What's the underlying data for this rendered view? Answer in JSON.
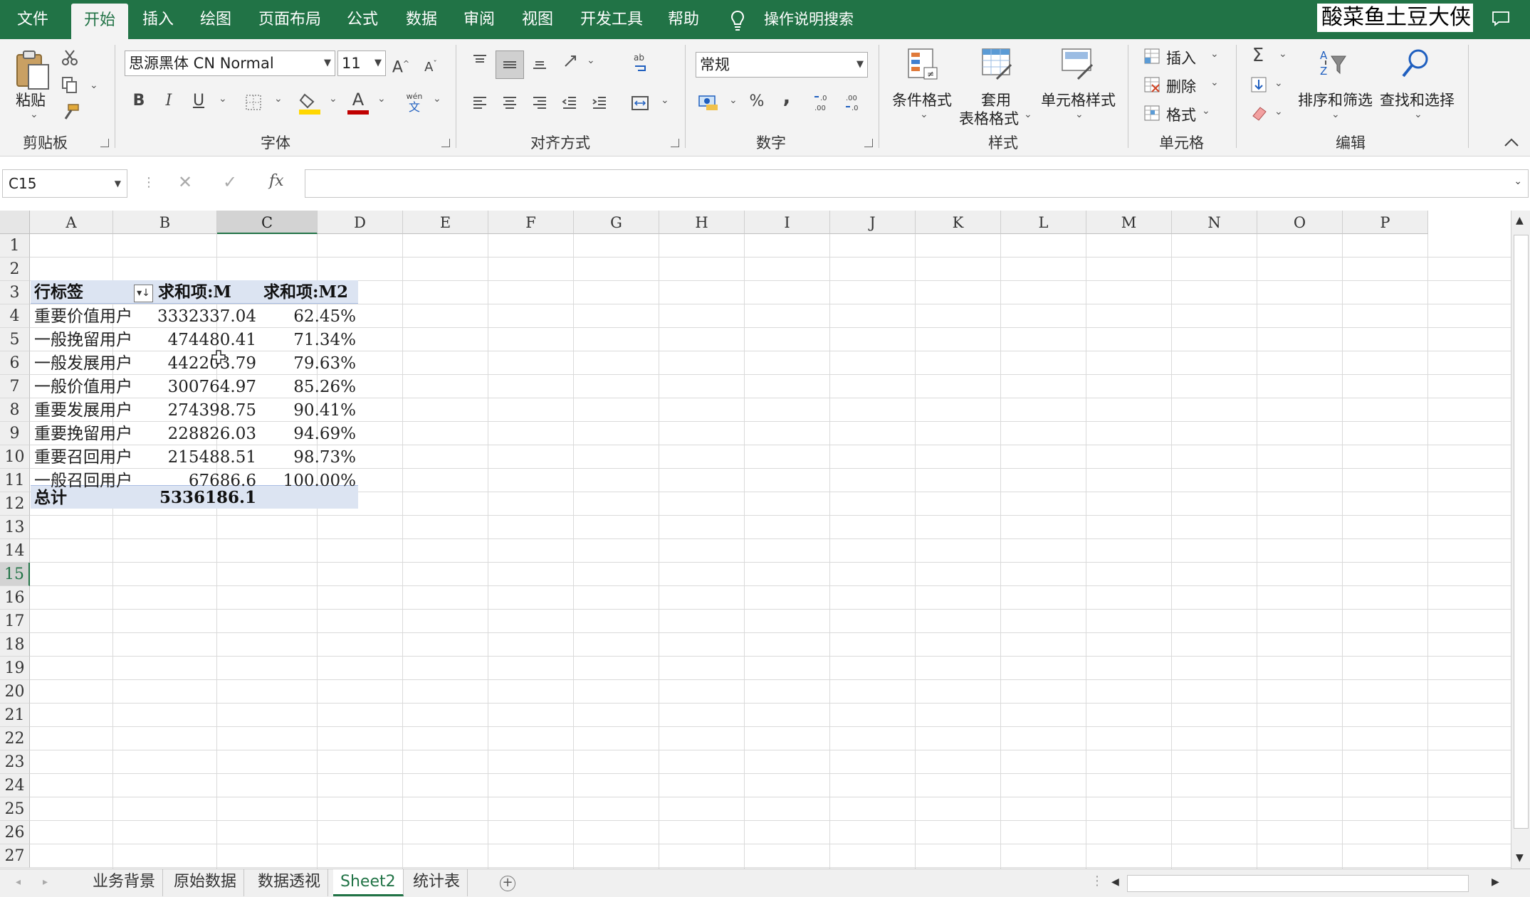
{
  "menu": {
    "file": "文件",
    "home": "开始",
    "insert": "插入",
    "draw": "绘图",
    "page_layout": "页面布局",
    "formulas": "公式",
    "data": "数据",
    "review": "审阅",
    "view": "视图",
    "developer": "开发工具",
    "help": "帮助",
    "tell_me": "操作说明搜索",
    "user": "酸菜鱼土豆大侠"
  },
  "ribbon": {
    "clipboard": {
      "paste": "粘贴",
      "group": "剪贴板"
    },
    "font": {
      "family": "思源黑体 CN Normal",
      "size": "11",
      "group": "字体",
      "bold": "B",
      "italic": "I",
      "underline": "U",
      "grow": "A",
      "shrink": "A",
      "font_color": "A",
      "phonetic_top": "wén",
      "phonetic_bottom": "文"
    },
    "alignment": {
      "group": "对齐方式"
    },
    "number": {
      "format": "常规",
      "group": "数字",
      "percent": "%",
      "comma": ","
    },
    "styles": {
      "conditional": "条件格式",
      "table_line1": "套用",
      "table_line2": "表格格式",
      "cell_styles": "单元格样式",
      "group": "样式"
    },
    "cells": {
      "insert": "插入",
      "delete": "删除",
      "format": "格式",
      "group": "单元格"
    },
    "editing": {
      "sum": "Σ",
      "sort_filter": "排序和筛选",
      "find_select": "查找和选择",
      "group": "编辑"
    }
  },
  "formula_bar": {
    "name_box": "C15",
    "fx": "fx",
    "formula": ""
  },
  "columns": [
    "A",
    "B",
    "C",
    "D",
    "E",
    "F",
    "G",
    "H",
    "I",
    "J",
    "K",
    "L",
    "M",
    "N",
    "O",
    "P"
  ],
  "selected_column": "C",
  "rows": [
    "1",
    "2",
    "3",
    "4",
    "5",
    "6",
    "7",
    "8",
    "9",
    "10",
    "11",
    "12",
    "13",
    "14",
    "15",
    "16",
    "17",
    "18",
    "19",
    "20",
    "21",
    "22",
    "23",
    "24",
    "25",
    "26",
    "27"
  ],
  "selected_row": "15",
  "pivot": {
    "header": {
      "label": "行标签",
      "sum_m": "求和项:M",
      "sum_m2": "求和项:M2"
    },
    "rows": [
      {
        "label": "重要价值用户",
        "m": "3332337.04",
        "m2": "62.45%"
      },
      {
        "label": "一般挽留用户",
        "m": "474480.41",
        "m2": "71.34%"
      },
      {
        "label": "一般发展用户",
        "m": "442203.79",
        "m2": "79.63%"
      },
      {
        "label": "一般价值用户",
        "m": "300764.97",
        "m2": "85.26%"
      },
      {
        "label": "重要发展用户",
        "m": "274398.75",
        "m2": "90.41%"
      },
      {
        "label": "重要挽留用户",
        "m": "228826.03",
        "m2": "94.69%"
      },
      {
        "label": "重要召回用户",
        "m": "215488.51",
        "m2": "98.73%"
      },
      {
        "label": "一般召回用户",
        "m": "67686.6",
        "m2": "100.00%"
      }
    ],
    "total": {
      "label": "总计",
      "m": "5336186.1",
      "m2": ""
    }
  },
  "sheets": [
    "业务背景",
    "原始数据",
    "数据透视",
    "Sheet2",
    "统计表"
  ],
  "active_sheet": "Sheet2",
  "colors": {
    "accent": "#217346",
    "pivot_band": "#dce4f2",
    "font_color_bar": "#c00000",
    "fill_color_bar": "#ffd700"
  }
}
